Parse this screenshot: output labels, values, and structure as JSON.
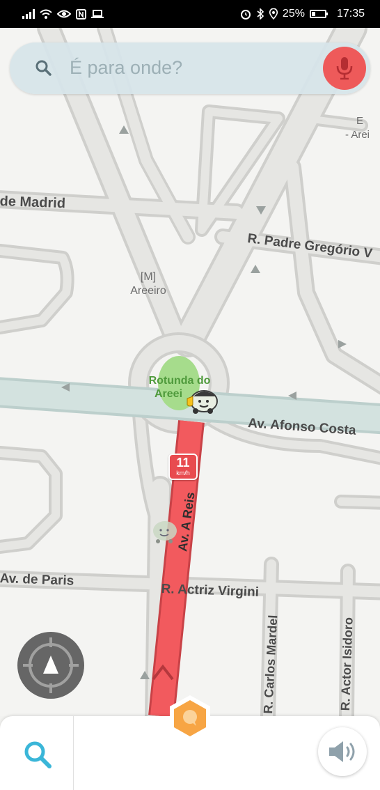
{
  "status_bar": {
    "left_icons": [
      "signal-icon",
      "wifi-icon",
      "eye-icon",
      "nfc-icon",
      "laptop-icon"
    ],
    "right_icons": [
      "alarm-icon",
      "bluetooth-icon",
      "location-icon"
    ],
    "battery": "25%",
    "battery_level": 0.25,
    "time": "17:35"
  },
  "search": {
    "placeholder": "É para onde?",
    "mic_color": "#ee5a5a"
  },
  "map": {
    "streets": {
      "madrid": "de Madrid",
      "padre_gregorio": "R. Padre Gregório V",
      "afonso_costa": "Av. Afonso Costa",
      "almirante_reis": "Av. A  Reis",
      "paris": "Av. de Paris",
      "actriz_virginia": "R. Actriz Virgini",
      "carlos_mardel": "R. Carlos Mardel",
      "actor_isidoro": "R. Actor Isidoro"
    },
    "pois": {
      "metro_symbol": "[M]",
      "metro_name": "Areeiro",
      "corner_line1": "E",
      "corner_line2": "- Arei",
      "rotunda_line1": "Rotunda do",
      "rotunda_line2": "Areei"
    },
    "route_color": "#f25a5e",
    "park_color": "#a6dc8c",
    "speed": {
      "value": "11",
      "unit": "km/h"
    }
  },
  "bottom_bar": {
    "search_icon": "search-icon",
    "report_icon": "report-hexagon-icon",
    "sound_icon": "speaker-icon"
  }
}
